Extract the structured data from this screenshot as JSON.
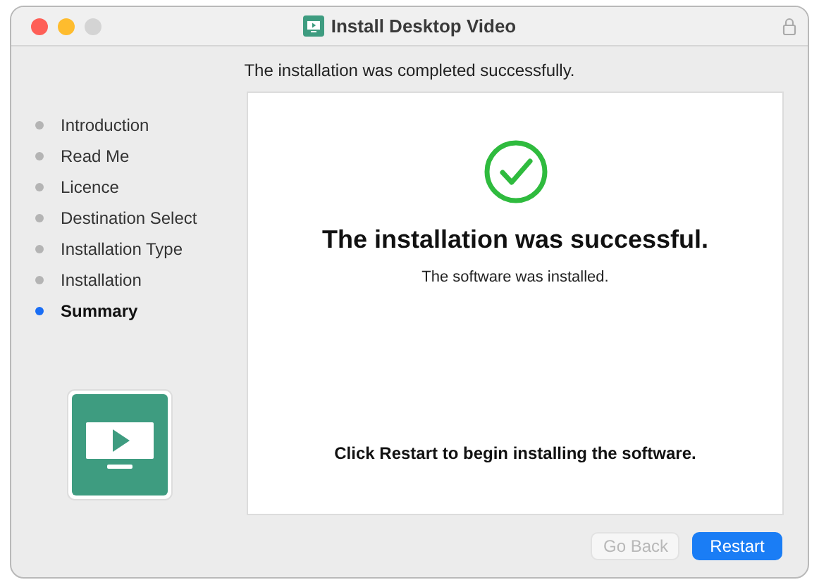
{
  "window": {
    "title": "Install Desktop Video"
  },
  "header": "The installation was completed successfully.",
  "steps": [
    {
      "label": "Introduction",
      "selected": false
    },
    {
      "label": "Read Me",
      "selected": false
    },
    {
      "label": "Licence",
      "selected": false
    },
    {
      "label": "Destination Select",
      "selected": false
    },
    {
      "label": "Installation Type",
      "selected": false
    },
    {
      "label": "Installation",
      "selected": false
    },
    {
      "label": "Summary",
      "selected": true
    }
  ],
  "panel": {
    "heading": "The installation was successful.",
    "subtext": "The software was installed.",
    "note": "Click Restart to begin installing the software."
  },
  "buttons": [
    {
      "label": "Go Back",
      "kind": "secondary",
      "disabled": true
    },
    {
      "label": "Restart",
      "kind": "primary",
      "disabled": false
    }
  ]
}
